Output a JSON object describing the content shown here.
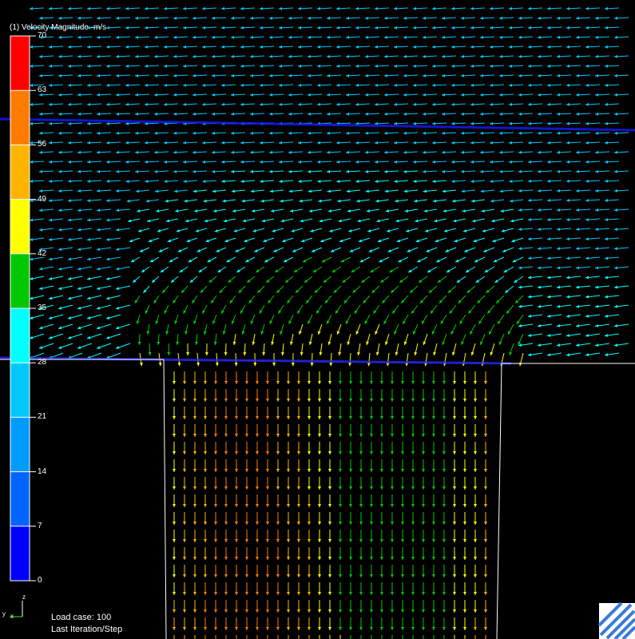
{
  "legend": {
    "title": "(1) Velocity Magnitude -m/s",
    "ticks": [
      "70",
      "63",
      "56",
      "49",
      "42",
      "35",
      "28",
      "21",
      "14",
      "7",
      "0"
    ],
    "band_colors": [
      "#ff0000",
      "#ff7b00",
      "#ffb400",
      "#ffff00",
      "#00c800",
      "#00ffff",
      "#00c8ff",
      "#009bff",
      "#0064ff",
      "#0000ff"
    ]
  },
  "status": {
    "load_case": "Load case: 100",
    "iteration": "Last Iteration/Step"
  },
  "triad": {
    "z": "z",
    "y": "y",
    "x": "x"
  },
  "scene": {
    "background": "#000000",
    "outline_color": "#ffffff",
    "boundary_color": "#0000ff",
    "logo_color": "#4a90d9"
  }
}
